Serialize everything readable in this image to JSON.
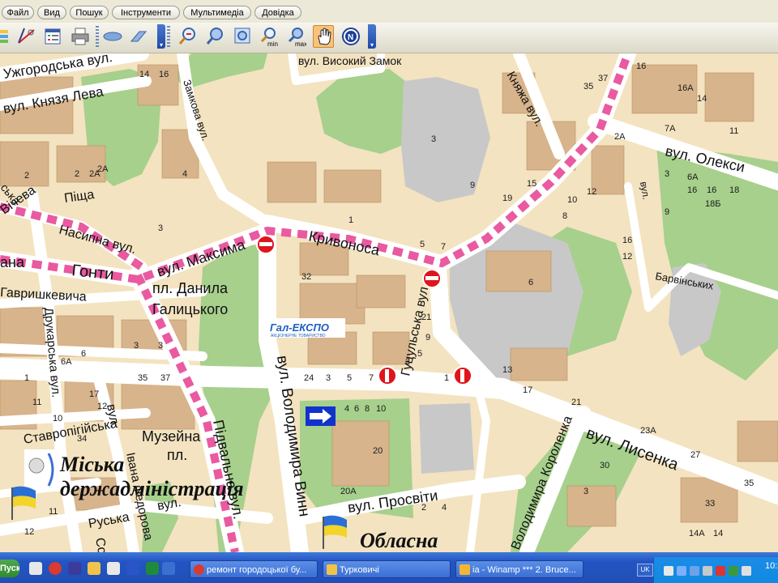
{
  "menu": [
    "Файл",
    "Вид",
    "Пошук",
    "Інструменти",
    "Мультимедіа",
    "Довідка"
  ],
  "toolbar": {
    "buttons": [
      {
        "name": "layers-icon"
      },
      {
        "name": "measure-icon"
      },
      {
        "name": "legend-icon"
      },
      {
        "name": "print-icon"
      },
      {
        "name": "eye-icon"
      },
      {
        "name": "eraser-icon"
      },
      {
        "name": "zoom-in-icon"
      },
      {
        "name": "zoom-icon"
      },
      {
        "name": "zoom-window-icon"
      },
      {
        "name": "zoom-min-icon",
        "label": "min"
      },
      {
        "name": "zoom-max-icon",
        "label": "max"
      },
      {
        "name": "hand-pan-icon",
        "active": true
      },
      {
        "name": "north-icon",
        "label": "N"
      }
    ]
  },
  "map": {
    "streets": {
      "uzhhorodska": "Ужгородська вул.",
      "kniazia_lva": "вул. Князя Лева",
      "zamkova": "Замкова вул.",
      "vysokyi_zamok": "вул. Високий Замок",
      "kniazha": "Княжа вул.",
      "oleksy": "вул. Олекси",
      "pidvalna_top": "Підвальна вул.",
      "pishcha": "Піща",
      "vicheva": "Вічева",
      "nasypna": "Насипна вул.",
      "honty": "Гонти",
      "maksyma": "вул. Максима",
      "kryvonosa": "Кривоноса",
      "danyla": "пл. Данила",
      "halytskoho": "Галицького",
      "gavryshkevycha": "Гавришкевича",
      "drukarska": "Друкарська вул.",
      "hutsulska": "Гуцульська вул.",
      "barvinskykh": "Барвінських",
      "vynnychenka": "вул. Володимира Винн",
      "stavropihiiska": "Ставропігійська",
      "muzeina": "Музейна",
      "muzeina_pl": "пл.",
      "fedorova": "Івана Федорова",
      "ruska": "Руська",
      "prosvity": "вул. Просвіти",
      "korolenka": "Володимира Короленка",
      "lysenka": "вул. Лисенка",
      "ukrainska": "Українська вул.",
      "pidvalna": "Підвальна вул.",
      "fragment_ana": "ана",
      "fragment_ska": "ська",
      "fragment_kova": "кова",
      "fragment_so": "Со",
      "fragment_vul": "вул.",
      "fragment_vul2": "вул.",
      "fragment_vul3": "вул."
    },
    "logos": {
      "galexpo": "Гал-ЕКСПО",
      "galexpo_sub": "АКЦІОНЕРНЕ ТОВАРИСТВО",
      "city_admin_1": "Міська",
      "city_admin_2": "держадміністрація",
      "oblast": "Обласна"
    },
    "colors": {
      "background": "#f3e3c0",
      "roads": "#ffffff",
      "parks": "#a6d08c",
      "blocks": "#d7b48c",
      "plaza": "#c8c8c8",
      "route": "#e95aa0",
      "no_entry": "#e0141b",
      "one_way": "#1133cc"
    }
  },
  "taskbar": {
    "start": "Пуск",
    "tasks": [
      {
        "label": "ремонт городоцької бу..."
      },
      {
        "label": "Турковичі"
      },
      {
        "label": "ia - Winamp *** 2. Bruce..."
      }
    ],
    "tray_lang": "UK",
    "clock": "10:3"
  }
}
